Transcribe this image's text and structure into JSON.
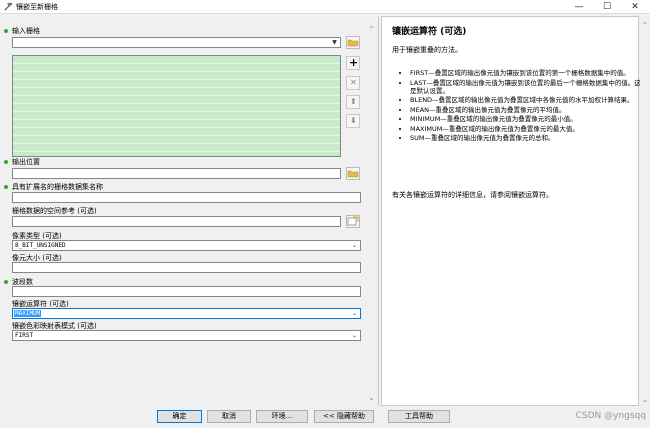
{
  "window": {
    "title": "镶嵌至新栅格",
    "minimize": "—",
    "maximize": "☐",
    "close": "✕"
  },
  "form": {
    "input_rasters_label": "输入栅格",
    "output_location_label": "输出位置",
    "dataset_name_label": "具有扩展名的栅格数据集名称",
    "spatial_ref_label": "栅格数据的空间参考 (可选)",
    "pixel_type_label": "像素类型 (可选)",
    "pixel_type_value": "8_BIT_UNSIGNED",
    "cellsize_label": "像元大小 (可选)",
    "bands_label": "波段数",
    "mosaic_operator_label": "镶嵌运算符 (可选)",
    "mosaic_operator_value": "MAXIMUM",
    "colormap_mode_label": "镶嵌色彩映射表模式 (可选)",
    "colormap_mode_value": "FIRST"
  },
  "side_buttons": {
    "add": "+",
    "remove": "✕",
    "up": "⬆",
    "down": "⬇"
  },
  "help": {
    "title": "镶嵌运算符 (可选)",
    "description": "用于镶嵌重叠的方法。",
    "items": [
      "FIRST—叠置区域的输出像元值为镶嵌到该位置的第一个栅格数据集中的值。",
      "LAST—叠置区域的输出像元值为镶嵌到该位置的最后一个栅格数据集中的值。这是默认设置。",
      "BLEND—叠置区域的输出像元值为叠置区域中各像元值的水平加权计算结果。",
      "MEAN—重叠区域的输出像元值为叠置像元的平均值。",
      "MINIMUM—重叠区域的输出像元值为叠置像元的最小值。",
      "MAXIMUM—重叠区域的输出像元值为叠置像元的最大值。",
      "SUM—重叠区域的输出像元值为叠置像元的总和。"
    ],
    "more": "有关各镶嵌运算符的详细信息，请参阅镶嵌运算符。"
  },
  "buttons": {
    "ok": "确定",
    "cancel": "取消",
    "environments": "环境...",
    "hide_help": "<< 隐藏帮助",
    "tool_help": "工具帮助"
  },
  "watermark": "CSDN @yngsqq",
  "colors": {
    "required_dot": "#2eaa2e",
    "list_bg": "#c8eac8",
    "selection": "#3399ff"
  }
}
